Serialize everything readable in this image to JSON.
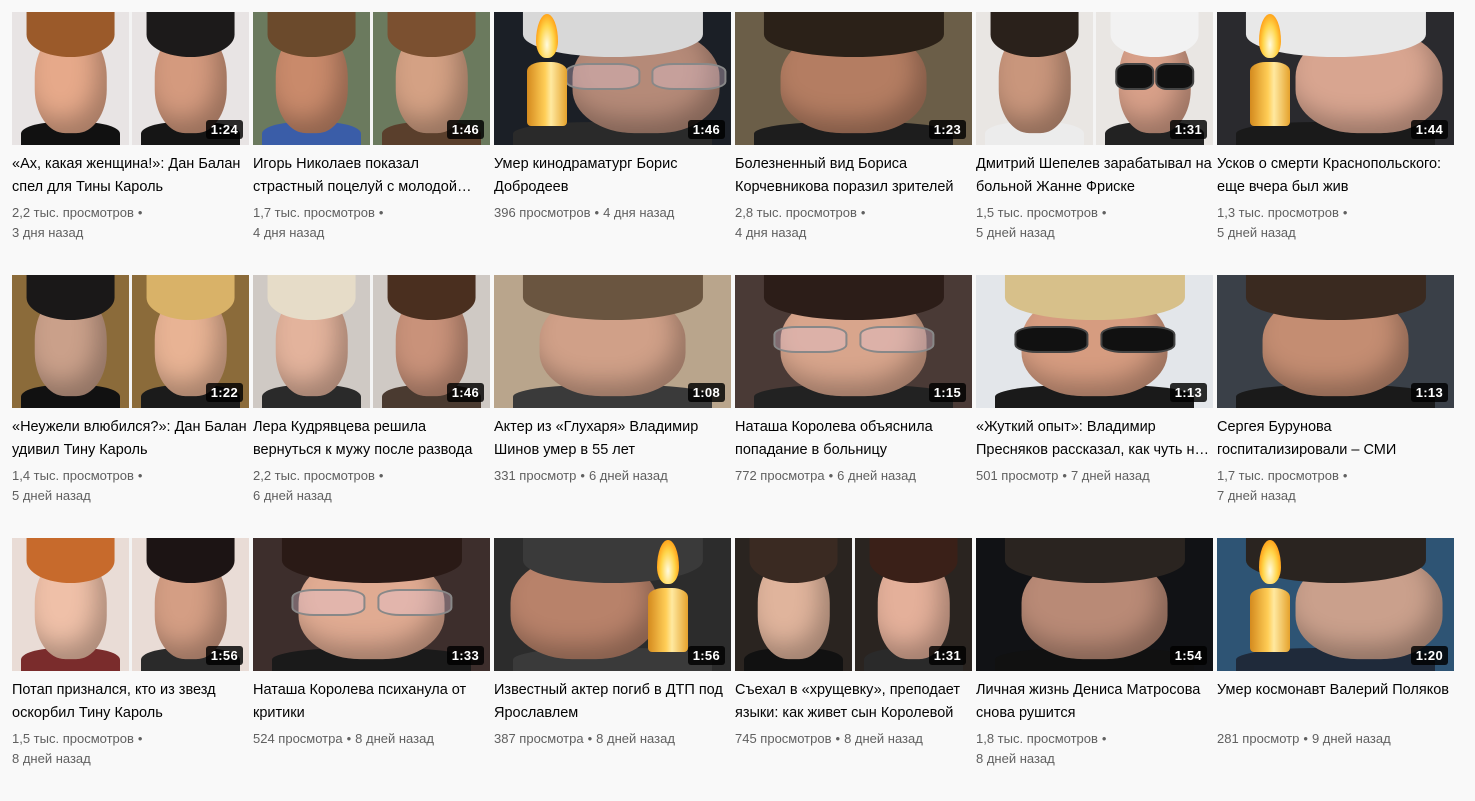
{
  "colors": {
    "page_bg": "#f9f9f9",
    "title_text": "#030303",
    "meta_text": "#606060",
    "duration_bg": "#000000",
    "duration_text": "#ffffff"
  },
  "videos": [
    {
      "title": "«Ах, какая женщина!»: Дан Балан спел для Тины Кароль",
      "views": "2,2 тыс. просмотров",
      "age": "3 дня назад",
      "duration": "1:24",
      "thumb": {
        "bg": "#e8e4e4",
        "panels": [
          {
            "skin": "#e6a98a",
            "hair": "#9b5a2a",
            "shirt": "#111"
          },
          {
            "skin": "#d49a7e",
            "hair": "#1c1a1a",
            "shirt": "#151515"
          }
        ]
      }
    },
    {
      "title": "Игорь Николаев показал страстный поцелуй с молодой женой",
      "views": "1,7 тыс. просмотров",
      "age": "4 дня назад",
      "duration": "1:46",
      "thumb": {
        "bg": "#6b7a5e",
        "panels": [
          {
            "skin": "#c98a6b",
            "hair": "#6b4a2c",
            "shirt": "#3a5da8"
          },
          {
            "skin": "#d4a184",
            "hair": "#7b5030",
            "shirt": "#5a3f2c"
          }
        ]
      }
    },
    {
      "title": "Умер кинодраматург Борис Добродеев",
      "views": "396 просмотров",
      "age": "4 дня назад",
      "duration": "1:46",
      "inline_meta": true,
      "thumb": {
        "bg": "#1b1f26",
        "candle": true,
        "panels": [
          {
            "skin": "#b58a78",
            "hair": "#d8d8d8",
            "shirt": "#2a2a2a",
            "glasses": "light"
          }
        ]
      }
    },
    {
      "title": "Болезненный вид Бориса Корчевникова поразил зрителей",
      "views": "2,8 тыс. просмотров",
      "age": "4 дня назад",
      "duration": "1:23",
      "thumb": {
        "bg": "#6b5e48",
        "panels": [
          {
            "skin": "#b47d62",
            "hair": "#2b2118",
            "shirt": "#1d1d1d"
          }
        ]
      }
    },
    {
      "title": "Дмитрий Шепелев зарабатывал на больной Жанне Фриске",
      "views": "1,5 тыс. просмотров",
      "age": "5 дней назад",
      "duration": "1:31",
      "thumb": {
        "bg": "#e9e6e3",
        "panels": [
          {
            "skin": "#c9967c",
            "hair": "#2a211b",
            "shirt": "#ececec"
          },
          {
            "skin": "#d8a089",
            "hair": "#f2f2f2",
            "shirt": "#222",
            "glasses": "dark"
          }
        ]
      }
    },
    {
      "title": "Усков о смерти Краснопольского: еще вчера был жив",
      "views": "1,3 тыс. просмотров",
      "age": "5 дней назад",
      "duration": "1:44",
      "thumb": {
        "bg": "#2a2a2e",
        "candle": true,
        "panels": [
          {
            "skin": "#d8a590",
            "hair": "#e8e8e8",
            "shirt": "#1a1a1a"
          }
        ]
      }
    },
    {
      "title": "«Неужели влюбился?»: Дан Балан удивил Тину Кароль",
      "views": "1,4 тыс. просмотров",
      "age": "5 дней назад",
      "duration": "1:22",
      "thumb": {
        "bg": "#8b6b3a",
        "panels": [
          {
            "skin": "#caa08a",
            "hair": "#1a1818",
            "shirt": "#111"
          },
          {
            "skin": "#e8b394",
            "hair": "#d9b268",
            "shirt": "#1b1b1b"
          }
        ]
      }
    },
    {
      "title": "Лера Кудрявцева решила вернуться к мужу после развода",
      "views": "2,2 тыс. просмотров",
      "age": "6 дней назад",
      "duration": "1:46",
      "thumb": {
        "bg": "#cfc9c4",
        "panels": [
          {
            "skin": "#e3b39c",
            "hair": "#e6dcc8",
            "shirt": "#2a2a2a"
          },
          {
            "skin": "#c9927a",
            "hair": "#4a2f1f",
            "shirt": "#4a3a30"
          }
        ]
      }
    },
    {
      "title": "Актер из «Глухаря» Владимир Шинов умер в 55 лет",
      "views": "331 просмотр",
      "age": "6 дней назад",
      "duration": "1:08",
      "inline_meta": true,
      "thumb": {
        "bg": "#b9a58c",
        "panels": [
          {
            "skin": "#d0a088",
            "hair": "#6a5540",
            "shirt": "#3a3a3a"
          }
        ]
      }
    },
    {
      "title": "Наташа Королева объяснила попадание в больницу",
      "views": "772 просмотра",
      "age": "6 дней назад",
      "duration": "1:15",
      "inline_meta": true,
      "thumb": {
        "bg": "#4a3a36",
        "panels": [
          {
            "skin": "#d8a58c",
            "hair": "#2c1d18",
            "shirt": "#222",
            "glasses": "light"
          }
        ]
      }
    },
    {
      "title": "«Жуткий опыт»: Владимир Пресняков рассказал, как чуть не умер",
      "views": "501 просмотр",
      "age": "7 дней назад",
      "duration": "1:13",
      "inline_meta": true,
      "thumb": {
        "bg": "#e3e6ea",
        "panels": [
          {
            "skin": "#d69c80",
            "hair": "#d7c08a",
            "shirt": "#1a1a1a",
            "glasses": "dark"
          }
        ]
      }
    },
    {
      "title": "Сергея Бурунова госпитализировали – СМИ",
      "views": "1,7 тыс. просмотров",
      "age": "7 дней назад",
      "duration": "1:13",
      "thumb": {
        "bg": "#3a4048",
        "panels": [
          {
            "skin": "#c48d72",
            "hair": "#3a2a20",
            "shirt": "#1a1a1a"
          }
        ]
      }
    },
    {
      "title": "Потап признался, кто из звезд оскорбил Тину Кароль",
      "views": "1,5 тыс. просмотров",
      "age": "8 дней назад",
      "duration": "1:56",
      "thumb": {
        "bg": "#e9dcd6",
        "panels": [
          {
            "skin": "#efc0a8",
            "hair": "#c76a2c",
            "shirt": "#7a2c2c"
          },
          {
            "skin": "#d49e84",
            "hair": "#1c1414",
            "shirt": "#2a2a2a"
          }
        ]
      }
    },
    {
      "title": "Наташа Королева психанула от критики",
      "views": "524 просмотра",
      "age": "8 дней назад",
      "duration": "1:33",
      "inline_meta": true,
      "thumb": {
        "bg": "#3d2e2c",
        "panels": [
          {
            "skin": "#e0ab92",
            "hair": "#2a1a16",
            "shirt": "#1a1a1a",
            "glasses": "light"
          }
        ]
      }
    },
    {
      "title": "Известный актер погиб в ДТП под Ярославлем",
      "views": "387 просмотра",
      "age": "8 дней назад",
      "duration": "1:56",
      "inline_meta": true,
      "thumb": {
        "bg": "#2c2c2c",
        "candle_right": true,
        "panels": [
          {
            "skin": "#b8826a",
            "hair": "#3a3a3a",
            "shirt": "#3a3a3a"
          }
        ]
      }
    },
    {
      "title": "Съехал в «хрущевку», преподает языки: как живет сын Королевой",
      "views": "745 просмотров",
      "age": "8 дней назад",
      "duration": "1:31",
      "inline_meta": true,
      "thumb": {
        "bg": "#2a2420",
        "panels": [
          {
            "skin": "#e0b49c",
            "hair": "#3a2a22",
            "shirt": "#111"
          },
          {
            "skin": "#e4b09a",
            "hair": "#3a2018",
            "shirt": "#2a2a2a"
          }
        ]
      }
    },
    {
      "title": "Личная жизнь Дениса Матросова снова рушится",
      "views": "1,8 тыс. просмотров",
      "age": "8 дней назад",
      "duration": "1:54",
      "thumb": {
        "bg": "#111215",
        "panels": [
          {
            "skin": "#b98a76",
            "hair": "#2a2420",
            "shirt": "#111"
          }
        ]
      }
    },
    {
      "title": "Умер космонавт Валерий Поляков",
      "views": "281 просмотр",
      "age": "9 дней назад",
      "duration": "1:20",
      "inline_meta": true,
      "thumb": {
        "bg": "#2e5474",
        "candle": true,
        "panels": [
          {
            "skin": "#caa08c",
            "hair": "#2a2420",
            "shirt": "#1f2a3a"
          }
        ]
      }
    }
  ]
}
